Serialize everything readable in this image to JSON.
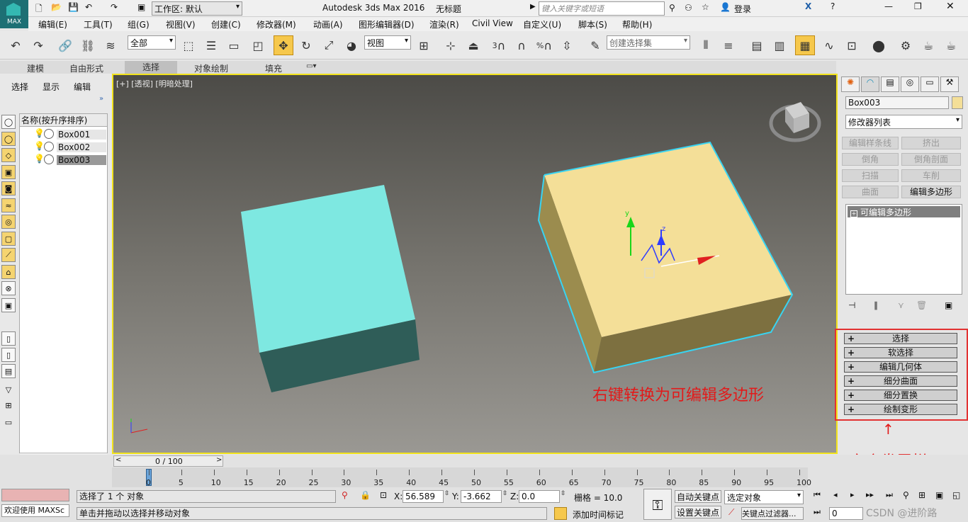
{
  "titlebar": {
    "workspace": "工作区: 默认",
    "app_title": "Autodesk 3ds Max 2016",
    "doc_title": "无标题",
    "search_placeholder": "键入关键字或短语",
    "login": "登录",
    "max_label": "MAX"
  },
  "menu": [
    "编辑(E)",
    "工具(T)",
    "组(G)",
    "视图(V)",
    "创建(C)",
    "修改器(M)",
    "动画(A)",
    "图形编辑器(D)",
    "渲染(R)",
    "Civil View",
    "自定义(U)",
    "脚本(S)",
    "帮助(H)"
  ],
  "toolbar": {
    "filter": "全部",
    "ref_coord": "视图",
    "selection_set": "创建选择集",
    "snap_3": "3",
    "snap_pct": "%"
  },
  "ribbon": {
    "tabs": [
      "建模",
      "自由形式",
      "选择",
      "对象绘制",
      "填充"
    ]
  },
  "explorer": {
    "tabs": [
      "选择",
      "显示",
      "编辑"
    ],
    "header": "名称(按升序排序)",
    "items": [
      "Box001",
      "Box002",
      "Box003"
    ],
    "frame": "0 / 100"
  },
  "viewport": {
    "label": "[+] [透视] [明暗处理]",
    "annotation": "右键转换为可编辑多边形",
    "colors": {
      "box1_top": "#7ee8e1",
      "box1_front": "#2f5d58",
      "box2_top": "#f4df98",
      "box2_side": "#9b8c4e"
    }
  },
  "command_panel": {
    "object_name": "Box003",
    "modifier_list": "修改器列表",
    "buttons": [
      "编辑样条线",
      "挤出",
      "倒角",
      "倒角剖面",
      "扫描",
      "车削",
      "曲面",
      "编辑多边形"
    ],
    "stack_item": "可编辑多边形",
    "rollouts": [
      "选择",
      "软选择",
      "编辑几何体",
      "细分曲面",
      "细分置换",
      "绘制变形"
    ],
    "annotation": "六个卷展栏"
  },
  "timeline": {
    "ticks": [
      "0",
      "5",
      "10",
      "15",
      "20",
      "25",
      "30",
      "35",
      "40",
      "45",
      "50",
      "55",
      "60",
      "65",
      "70",
      "75",
      "80",
      "85",
      "90",
      "95",
      "100"
    ]
  },
  "status": {
    "welcome": "欢迎使用 MAXSc",
    "selected": "选择了 1 个 对象",
    "hint": "单击并拖动以选择并移动对象",
    "x_label": "X:",
    "x": "56.589",
    "y_label": "Y:",
    "y": "-3.662",
    "z_label": "Z:",
    "z": "0.0",
    "grid": "栅格 = 10.0",
    "add_tag": "添加时间标记",
    "auto_key": "自动关键点",
    "set_key": "设置关键点",
    "selected_obj": "选定对象",
    "key_filter": "关键点过滤器...",
    "frame": "0",
    "watermark": "CSDN @进阶路"
  }
}
